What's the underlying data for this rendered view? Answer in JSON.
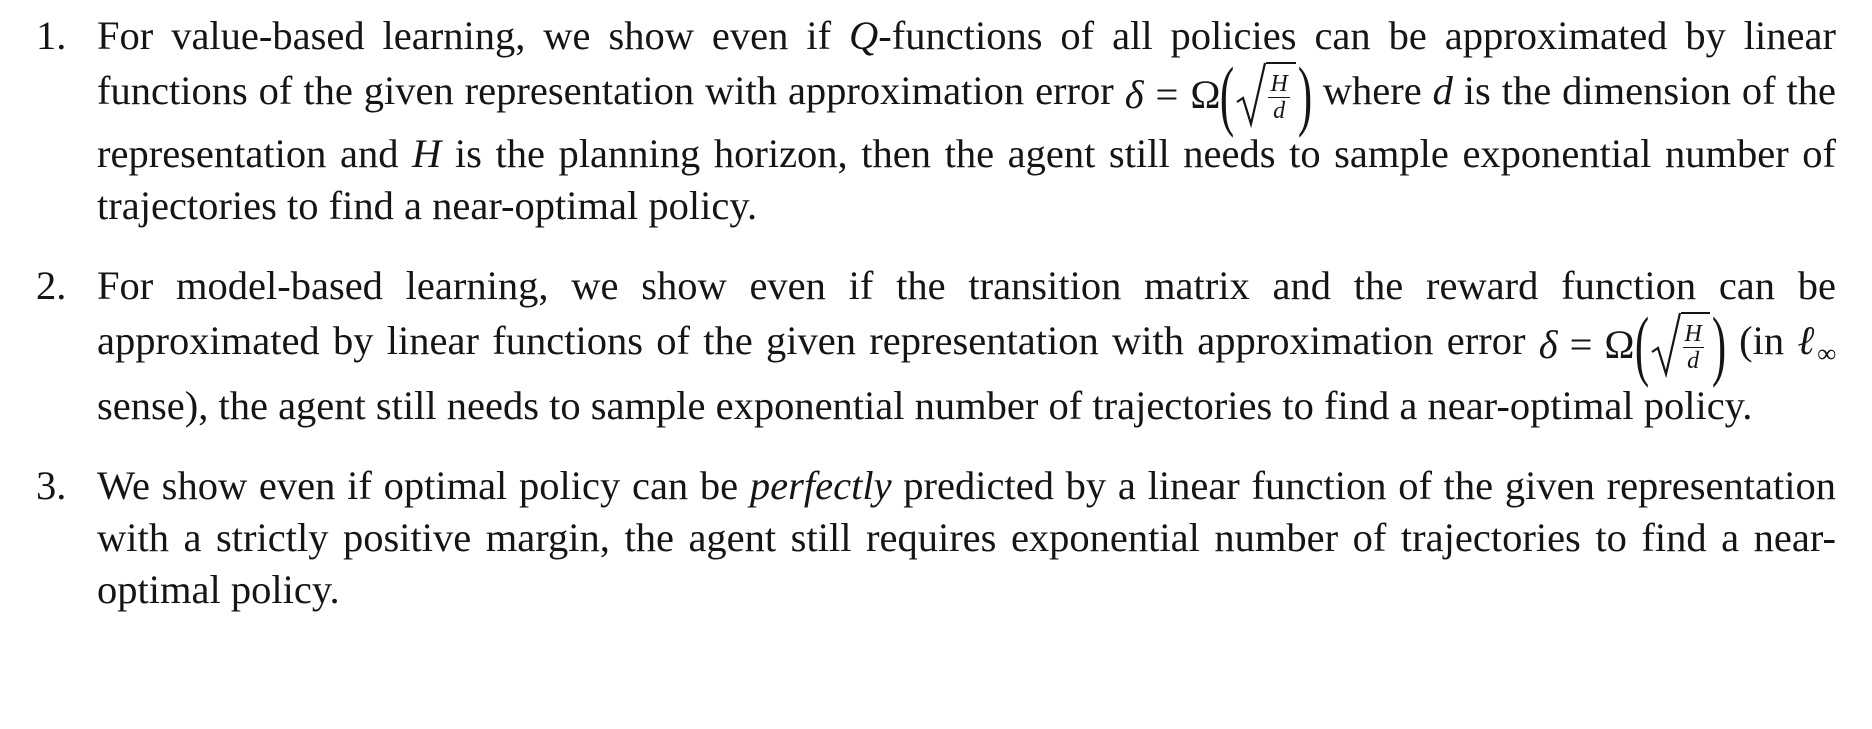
{
  "items": [
    {
      "number": "1.",
      "pre": "For value-based learning, we show even if ",
      "q_symbol": "Q",
      "mid": "-functions of all policies can be approximated by linear functions of the given representation with approximation error ",
      "formula": {
        "delta": "δ",
        "eq": "=",
        "omega": "Ω",
        "frac_num": "H",
        "frac_den": "d"
      },
      "where_pre": " where ",
      "d_symbol": "d",
      "where_mid": " is the dimension of the representation and ",
      "h_symbol": "H",
      "post": " is the planning horizon, then the agent still needs to sample exponential number of trajectories to find a near-optimal policy."
    },
    {
      "number": "2.",
      "pre": "For model-based learning, we show even if the transition matrix and the reward function can be approximated by linear functions of the given representation with approximation error ",
      "formula": {
        "delta": "δ",
        "eq": "=",
        "omega": "Ω",
        "frac_num": "H",
        "frac_den": "d"
      },
      "in_pre": " (in ",
      "ell": "ℓ",
      "ell_sub": "∞",
      "post": " sense), the agent still needs to sample exponential number of trajectories to find a near-optimal policy."
    },
    {
      "number": "3.",
      "pre": "We show even if optimal policy can be ",
      "emph": "perfectly",
      "post": " predicted by a linear function of the given representation with a strictly positive margin, the agent still requires exponential number of trajectories to find a near-optimal policy."
    }
  ]
}
